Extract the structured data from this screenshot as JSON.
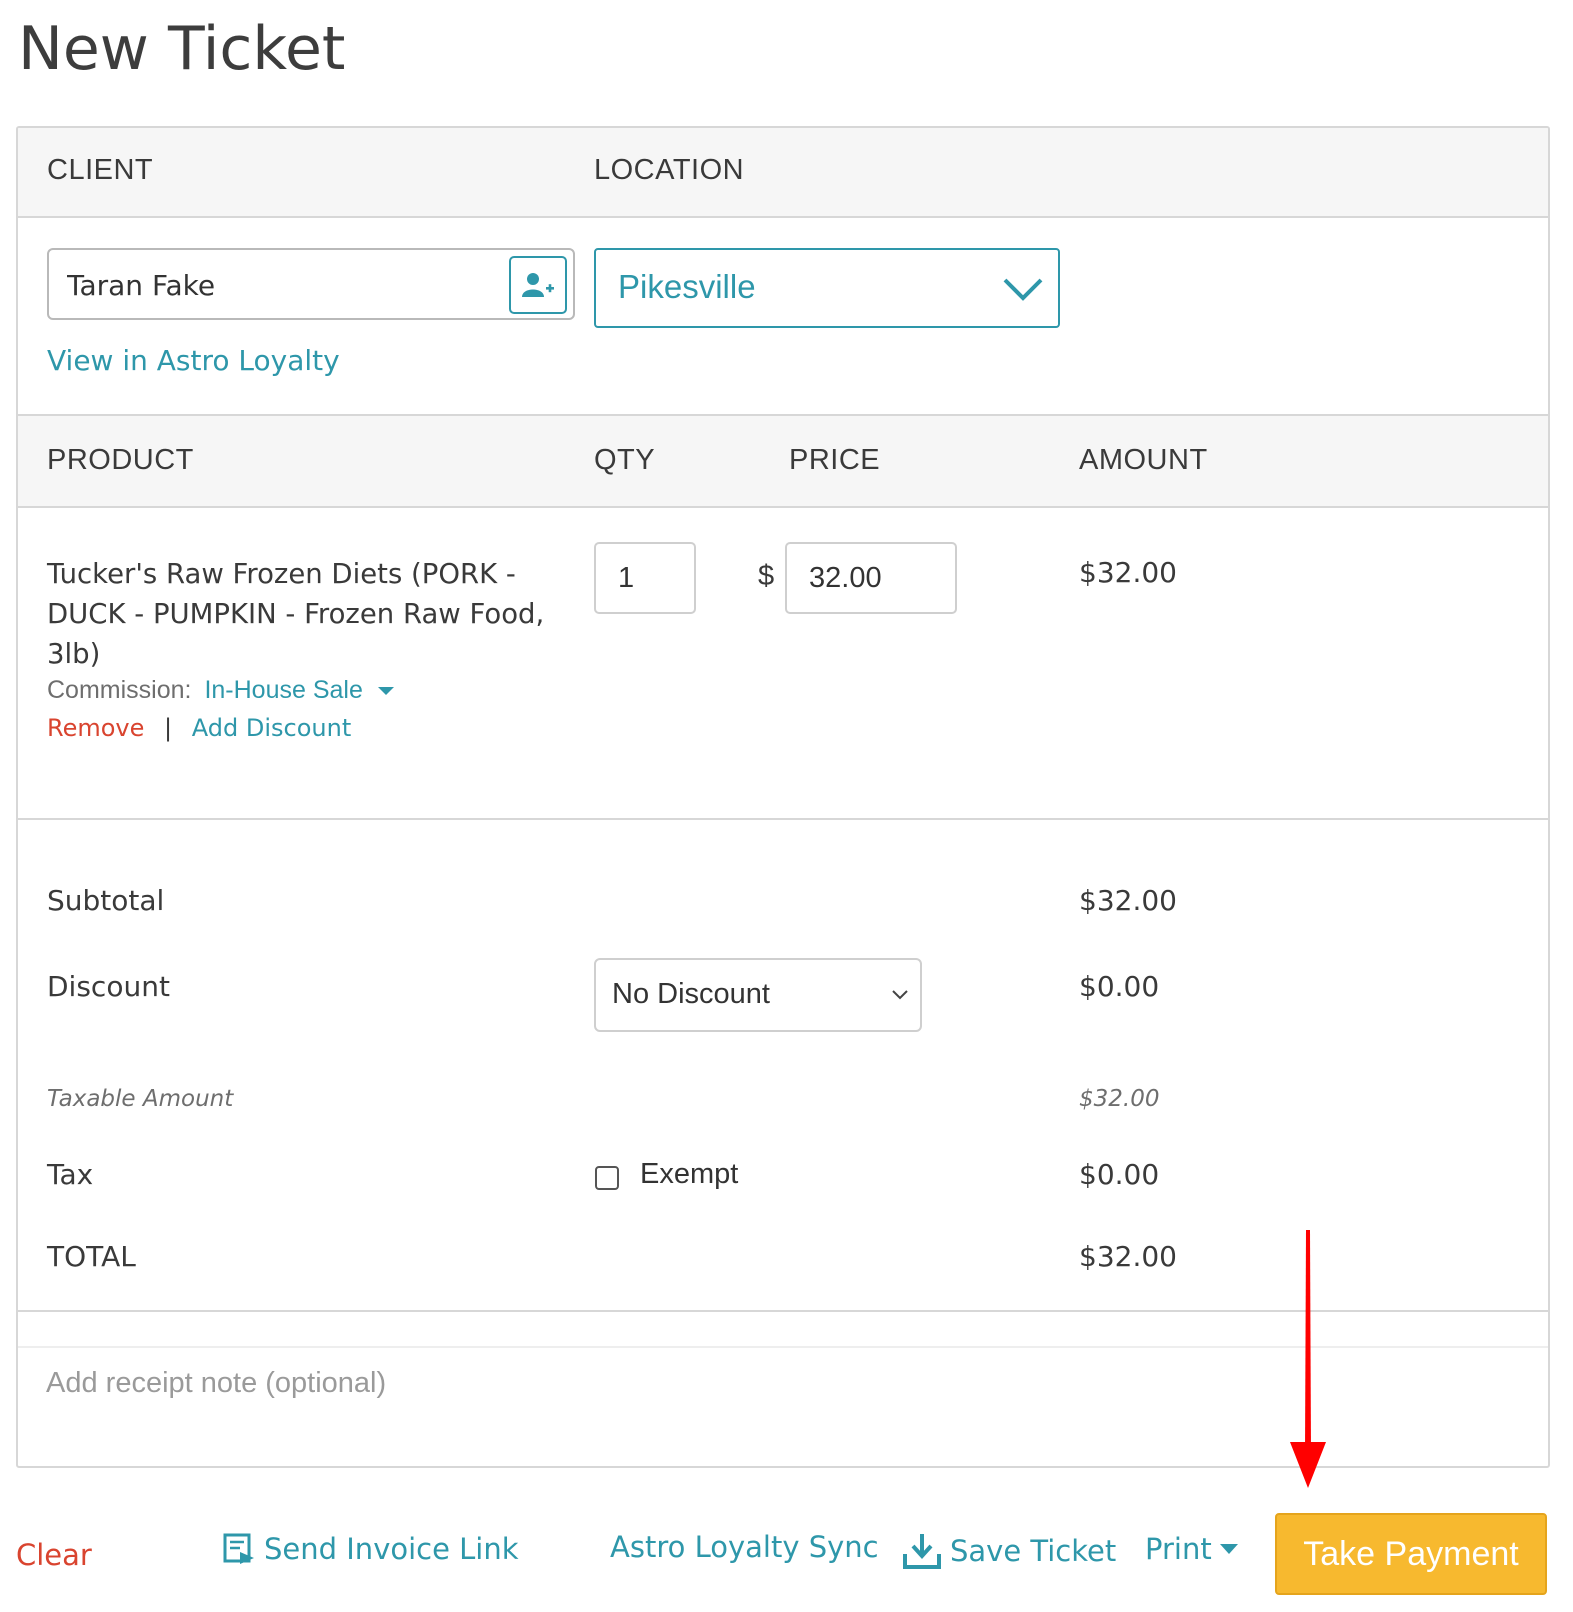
{
  "page": {
    "title": "New Ticket"
  },
  "client_section": {
    "client_header": "CLIENT",
    "location_header": "LOCATION",
    "client_value": "Taran Fake",
    "location_value": "Pikesville",
    "view_link": "View in Astro Loyalty"
  },
  "products": {
    "headers": {
      "product": "PRODUCT",
      "qty": "QTY",
      "price": "PRICE",
      "amount": "AMOUNT"
    },
    "items": [
      {
        "name": "Tucker's Raw Frozen Diets (PORK - DUCK - PUMPKIN - Frozen Raw Food, 3lb)",
        "commission_label": "Commission:",
        "commission_value": "In-House Sale",
        "remove_label": "Remove",
        "separator": "|",
        "add_discount_label": "Add Discount",
        "qty": "1",
        "currency": "$",
        "price": "32.00",
        "amount": "$32.00"
      }
    ]
  },
  "totals": {
    "subtotal_label": "Subtotal",
    "subtotal_value": "$32.00",
    "discount_label": "Discount",
    "discount_select": "No Discount",
    "discount_value": "$0.00",
    "taxable_label": "Taxable Amount",
    "taxable_value": "$32.00",
    "tax_label": "Tax",
    "exempt_label": "Exempt",
    "tax_value": "$0.00",
    "total_label": "TOTAL",
    "total_value": "$32.00"
  },
  "note": {
    "placeholder": "Add receipt note (optional)"
  },
  "footer": {
    "clear": "Clear",
    "send_invoice": "Send Invoice Link",
    "loyalty_sync": "Astro Loyalty Sync",
    "save_ticket": "Save Ticket",
    "print": "Print",
    "take_payment": "Take Payment"
  },
  "colors": {
    "accent": "#2e97aa",
    "danger": "#d9442f",
    "primary_button": "#f7b92f",
    "annotation_arrow": "#ff0000"
  }
}
